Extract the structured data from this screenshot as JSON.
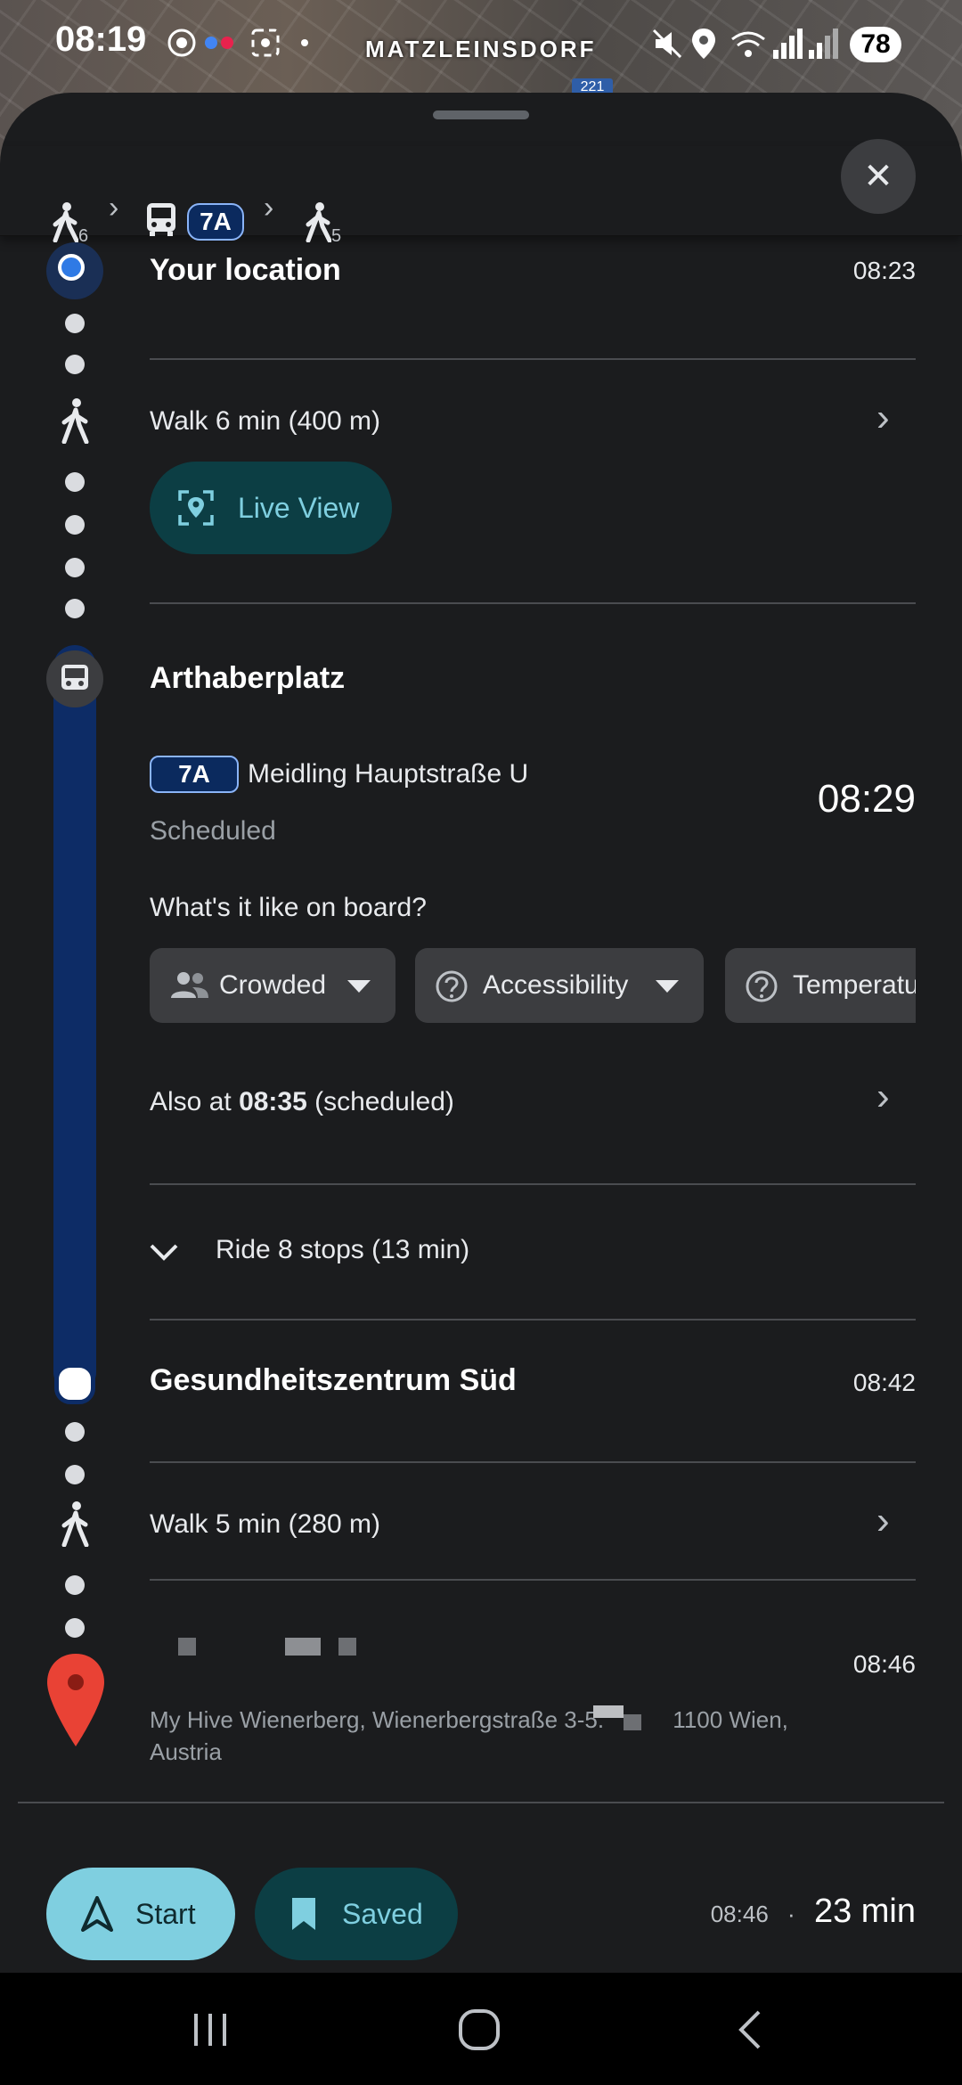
{
  "status_bar": {
    "time": "08:19",
    "battery": "78"
  },
  "map": {
    "area_label": "MATZLEINSDORF",
    "route_shield": "221"
  },
  "summary": {
    "walk1_minutes": "6",
    "bus_line": "7A",
    "walk2_minutes": "5"
  },
  "origin": {
    "label": "Your location",
    "time": "08:23"
  },
  "walk1": {
    "label": "Walk 6 min (400 m)",
    "live_view_label": "Live View"
  },
  "boarding": {
    "stop": "Arthaberplatz",
    "line": "7A",
    "headsign": "Meidling Hauptstraße U",
    "status": "Scheduled",
    "departure": "08:29",
    "onboard_question": "What's it like on board?",
    "chips": [
      "Crowded",
      "Accessibility",
      "Temperatu"
    ],
    "also_at_prefix": "Also at ",
    "also_at_time": "08:35",
    "also_at_suffix": " (scheduled)",
    "ride_label": "Ride 8 stops (13 min)"
  },
  "alight": {
    "stop": "Gesundheitszentrum Süd",
    "time": "08:42"
  },
  "walk2": {
    "label": "Walk 5 min (280 m)"
  },
  "destination": {
    "time": "08:46",
    "address_part1": "My Hive Wienerberg, Wienerbergstraße 3-5.",
    "address_part2": "1100 Wien,",
    "address_part3": "Austria"
  },
  "footer": {
    "start_label": "Start",
    "saved_label": "Saved",
    "arrival": "08:46",
    "separator": "·",
    "duration": "23 min"
  },
  "colors": {
    "accent": "#7fcfe0",
    "bus_line": "#0b2a5e",
    "dark_teal": "#0c3e44"
  }
}
